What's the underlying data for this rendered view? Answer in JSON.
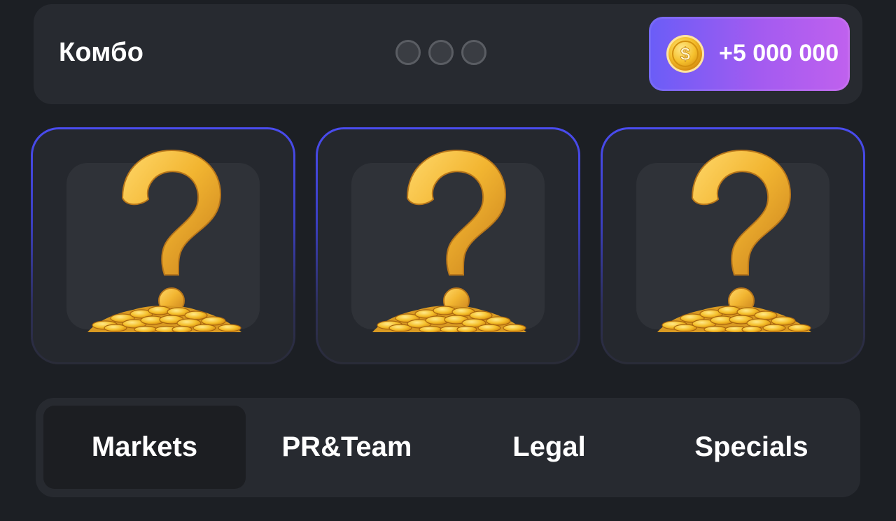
{
  "combo": {
    "title": "Комбо",
    "progress_dots": [
      {
        "filled": false
      },
      {
        "filled": false
      },
      {
        "filled": false
      }
    ],
    "reward": {
      "icon": "coin-icon",
      "amount": "+5 000 000"
    }
  },
  "cards": [
    {
      "state": "hidden",
      "icon": "question-mark-coins-icon"
    },
    {
      "state": "hidden",
      "icon": "question-mark-coins-icon"
    },
    {
      "state": "hidden",
      "icon": "question-mark-coins-icon"
    }
  ],
  "tabs": [
    {
      "label": "Markets",
      "active": true
    },
    {
      "label": "PR&Team",
      "active": false
    },
    {
      "label": "Legal",
      "active": false
    },
    {
      "label": "Specials",
      "active": false
    }
  ],
  "colors": {
    "background": "#1c1f24",
    "panel": "#272a30",
    "accent_start": "#6a5df7",
    "accent_end": "#c061ee",
    "card_border": "#4a4cf0",
    "gold": "#f2b531"
  }
}
